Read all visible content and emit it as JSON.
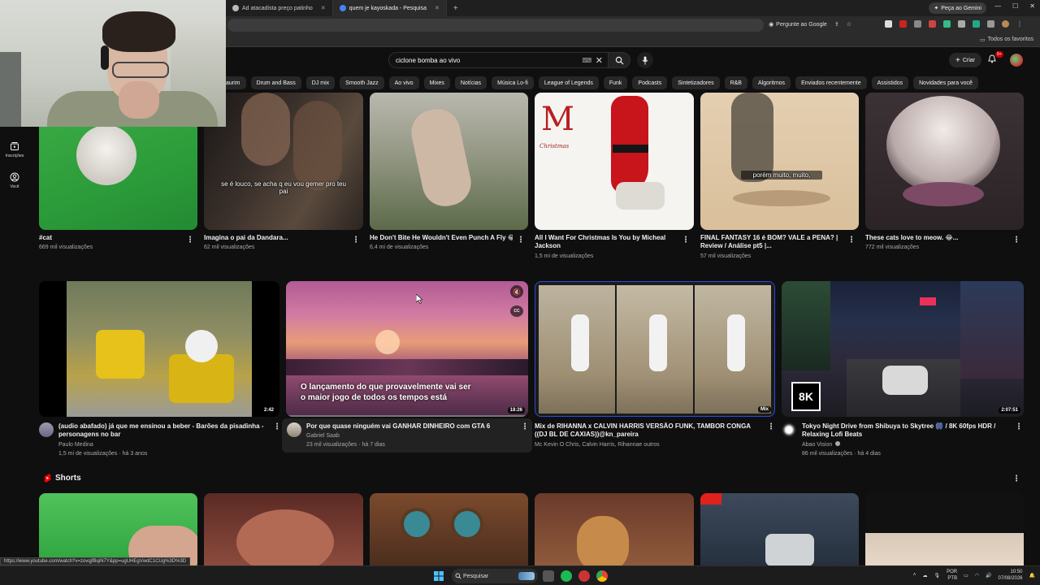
{
  "browser": {
    "tabs": [
      {
        "label": "Ad atacadista preço patinho"
      },
      {
        "label": "quem je kayoskada - Pesquisa"
      }
    ],
    "gemini_label": "Peça ao Gemini",
    "ask_google_label": "Pergunte ao Google",
    "bookmarks_all_label": "Todos os favoritos",
    "status_url": "https://www.youtube.com/watch?v=zovqjfBqiN7Y&pp=ugUHEgVwdC1CUg%3D%3D"
  },
  "youtube": {
    "search_value": "ciclone bomba  ao vivo",
    "create_label": "Criar",
    "notification_count": "9+",
    "chips": [
      "aurim",
      "Drum and Bass",
      "DJ mix",
      "Smooth Jazz",
      "Ao vivo",
      "Mixes",
      "Notícias",
      "Música Lo-fi",
      "League of Legends",
      "Funk",
      "Podcasts",
      "Sintetizadores",
      "R&B",
      "Algoritmos",
      "Enviados recentemente",
      "Assistidos",
      "Novidades para você"
    ],
    "guide": [
      {
        "label": "Inscrições",
        "icon": "subscriptions-icon"
      },
      {
        "label": "Você",
        "icon": "you-icon"
      }
    ],
    "row1": [
      {
        "title": "#cat",
        "meta": "669 mil visualizações"
      },
      {
        "title": "Imagina o pai da Dandara...",
        "meta": "62 mil visualizações",
        "caption": "se é louco, se acha q eu vou gemer pro teu pai"
      },
      {
        "title": "He Don't Bite He Wouldn't Even Punch A Fly 😂...",
        "meta": "6,4 mi de visualizações"
      },
      {
        "title": "All I Want For Christmas Is You by Micheal Jackson",
        "meta": "1,5 mi de visualizações",
        "thumb_text": "Christmas"
      },
      {
        "title": "FINAL FANTASY 16 é BOM? VALE a PENA? | Review / Análise pt5 |...",
        "meta": "57 mil visualizações",
        "caption": "porém muito, muito,"
      },
      {
        "title": "These cats love to meow. 😂...",
        "meta": "772 mil visualizações"
      }
    ],
    "row2": [
      {
        "title": "(audio abafado) já que me ensinou a beber - Barões da pisadinha - personagens no bar",
        "channel": "Paulo Medina",
        "meta": "1,5 mi de visualizações · há 3 anos",
        "duration": "2:42"
      },
      {
        "title": "Por que quase ninguém vai GANHAR DINHEIRO com GTA 6",
        "channel": "Gabriel Saab",
        "meta": "23 mil visualizações · há 7 dias",
        "duration": "18:26",
        "overlay": "O lançamento do que provavelmente vai ser o maior jogo de todos os tempos está",
        "cc": "CC"
      },
      {
        "title": "Mix de RIHANNA x CALVIN HARRIS VERSÃO FUNK, TAMBOR CONGA ((DJ BL DE CAXIAS))@kn_pareira",
        "channel": "Mc Kevin O Chris, Calvin Harris, Rihannae outros",
        "meta": "",
        "duration": "Mix"
      },
      {
        "title": "Tokyo Night Drive from Shibuya to Skytree 🎆 / 8K 60fps HDR / Relaxing Lofi Beats",
        "channel": "Abao Vision",
        "meta": "86 mil visualizações · há 4 dias",
        "duration": "2:07:51",
        "badge": "8K"
      }
    ],
    "shorts_label": "Shorts"
  },
  "taskbar": {
    "search_label": "Pesquisar",
    "lang": "POR",
    "lang2": "PTB",
    "time": "10:50",
    "date": "07/08/2026"
  },
  "colors": {
    "accent": "#ff0000",
    "bg": "#0f0f0f"
  }
}
